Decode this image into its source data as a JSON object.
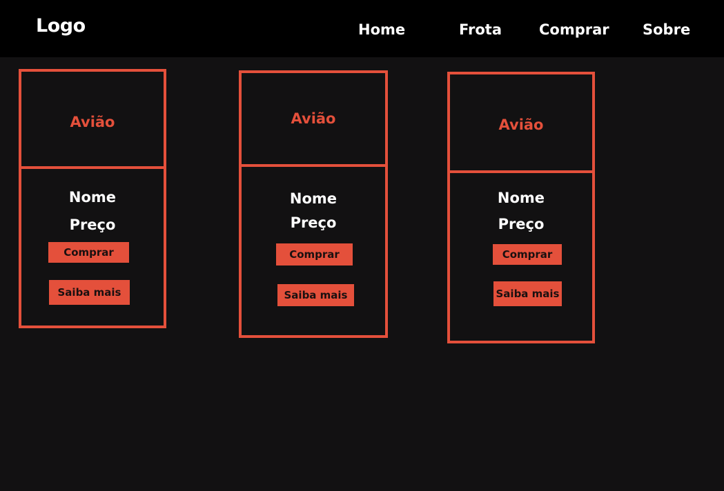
{
  "header": {
    "logo": "Logo",
    "nav": [
      {
        "label": "Home"
      },
      {
        "label": "Frota"
      },
      {
        "label": "Comprar"
      },
      {
        "label": "Sobre"
      }
    ]
  },
  "cards": [
    {
      "image_label": "Avião",
      "name": "Nome",
      "price": "Preço",
      "buy_label": "Comprar",
      "more_label": "Saiba mais"
    },
    {
      "image_label": "Avião",
      "name": "Nome",
      "price": "Preço",
      "buy_label": "Comprar",
      "more_label": "Saiba mais"
    },
    {
      "image_label": "Avião",
      "name": "Nome",
      "price": "Preço",
      "buy_label": "Comprar",
      "more_label": "Saiba mais"
    }
  ],
  "colors": {
    "background": "#121112",
    "header": "#000000",
    "accent": "#e4503b",
    "text": "#ffffff"
  }
}
